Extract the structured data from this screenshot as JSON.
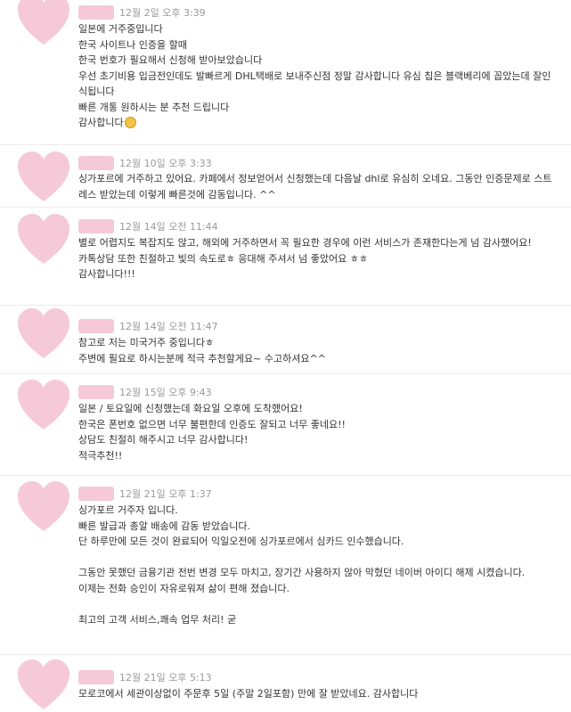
{
  "accent_color": "#f6c9d8",
  "reviews": [
    {
      "date": "12월 2일 오후 3:39",
      "lines": [
        "일본에 거주중입니다",
        "한국 사이트나 인증을 할때",
        "한국 번호가 필요해서 신청해 받아보았습니다",
        "우선 초기비용 입금전인데도 발빠르게 DHL택배로 보내주신점 정말 감사합니다 유심 칩은 블랙베리에 꼽았는데 잘인식됩니다",
        "빠른 개통 원하시는 분 추천 드립니다",
        "감사합니다"
      ]
    },
    {
      "date": "12월 10일 오후 3:33",
      "lines": [
        "싱가포르에 거주하고 있어요. 카페에서 정보얻어서 신청했는데 다음날 dhl로 유심히 오네요. 그동안 인증문제로 스트레스 받았는데 이렇게 빠른것에 감동입니다. ^^"
      ]
    },
    {
      "date": "12월 14일 오전 11:44",
      "lines": [
        "별로 어렵지도 복잡지도 않고, 해외에 거주하면서 꼭 필요한 경우에 이런 서비스가 존재한다는게 넘 감사했어요!",
        "카톡상담 또한 친절하고 빛의 속도로ㅎ 응대해 주셔서 넘 좋았어요 ㅎㅎ",
        "감사합니다!!!"
      ]
    },
    {
      "date": "12월 14일 오전 11:47",
      "lines": [
        "참고로 저는 미국거주 중입니다ㅎ",
        "주변에 필요로 하시는분께 적극 추천할게요~ 수고하셔요^^"
      ]
    },
    {
      "date": "12월 15일 오후 9:43",
      "lines": [
        "일본 / 토요일에 신청했는데 화요일 오후에 도착했어요!",
        "한국은 폰번호 없으면 너무 불편한데 인증도 잘되고 너무 좋네요!!",
        "상담도 친절히 해주시고 너무 감사합니다!",
        "적극추천!!"
      ]
    },
    {
      "date": "12월 21일 오후 1:37",
      "lines": [
        "싱가포르 거주자 입니다.",
        "빠른 발급과 총알 배송에 감동 받았습니다.",
        "단 하루만에 모든 것이 완료되어 익일오전에 싱가포르에서 심카드 인수했습니다.",
        "",
        "그동안 못했던 금융기관 전번 변경 모두 마치고, 장기간 사용하지 않아 막혔던 네이버 아이디 해제 시켰습니다.",
        "이제는 전화 승인이 자유로워져 삶이 편해 졌습니다.",
        "",
        "최고의 고객 서비스,쾌속 업무 처리! 굳"
      ]
    },
    {
      "date": "12월 21일 오후 5:13",
      "lines": [
        "모로코에서 세관이상없이 주문후 5일 (주말 2일포함) 만에 잘 받았네요. 감사합니다"
      ]
    }
  ]
}
